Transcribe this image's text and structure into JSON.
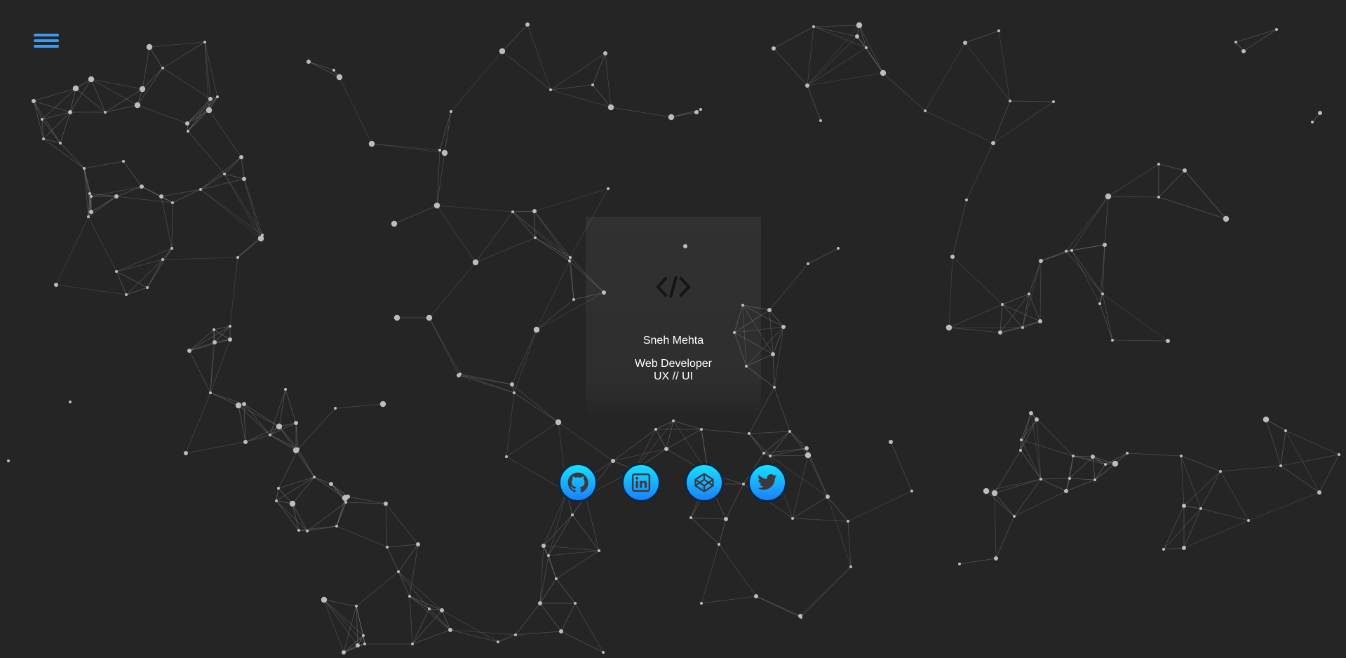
{
  "profile": {
    "name": "Sneh Mehta",
    "title": "Web Developer",
    "subtitle": "UX // UI"
  },
  "menu": {
    "icon": "hamburger-icon"
  },
  "socials": [
    {
      "name": "github",
      "icon": "github-icon"
    },
    {
      "name": "linkedin",
      "icon": "linkedin-icon"
    },
    {
      "name": "codepen",
      "icon": "codepen-icon"
    },
    {
      "name": "twitter",
      "icon": "twitter-icon"
    }
  ],
  "colors": {
    "background": "#252525",
    "accent": "#3d9bf0",
    "social_top": "#19e0ff",
    "social_bottom": "#1a7fff",
    "network": "#9a9a9a"
  }
}
